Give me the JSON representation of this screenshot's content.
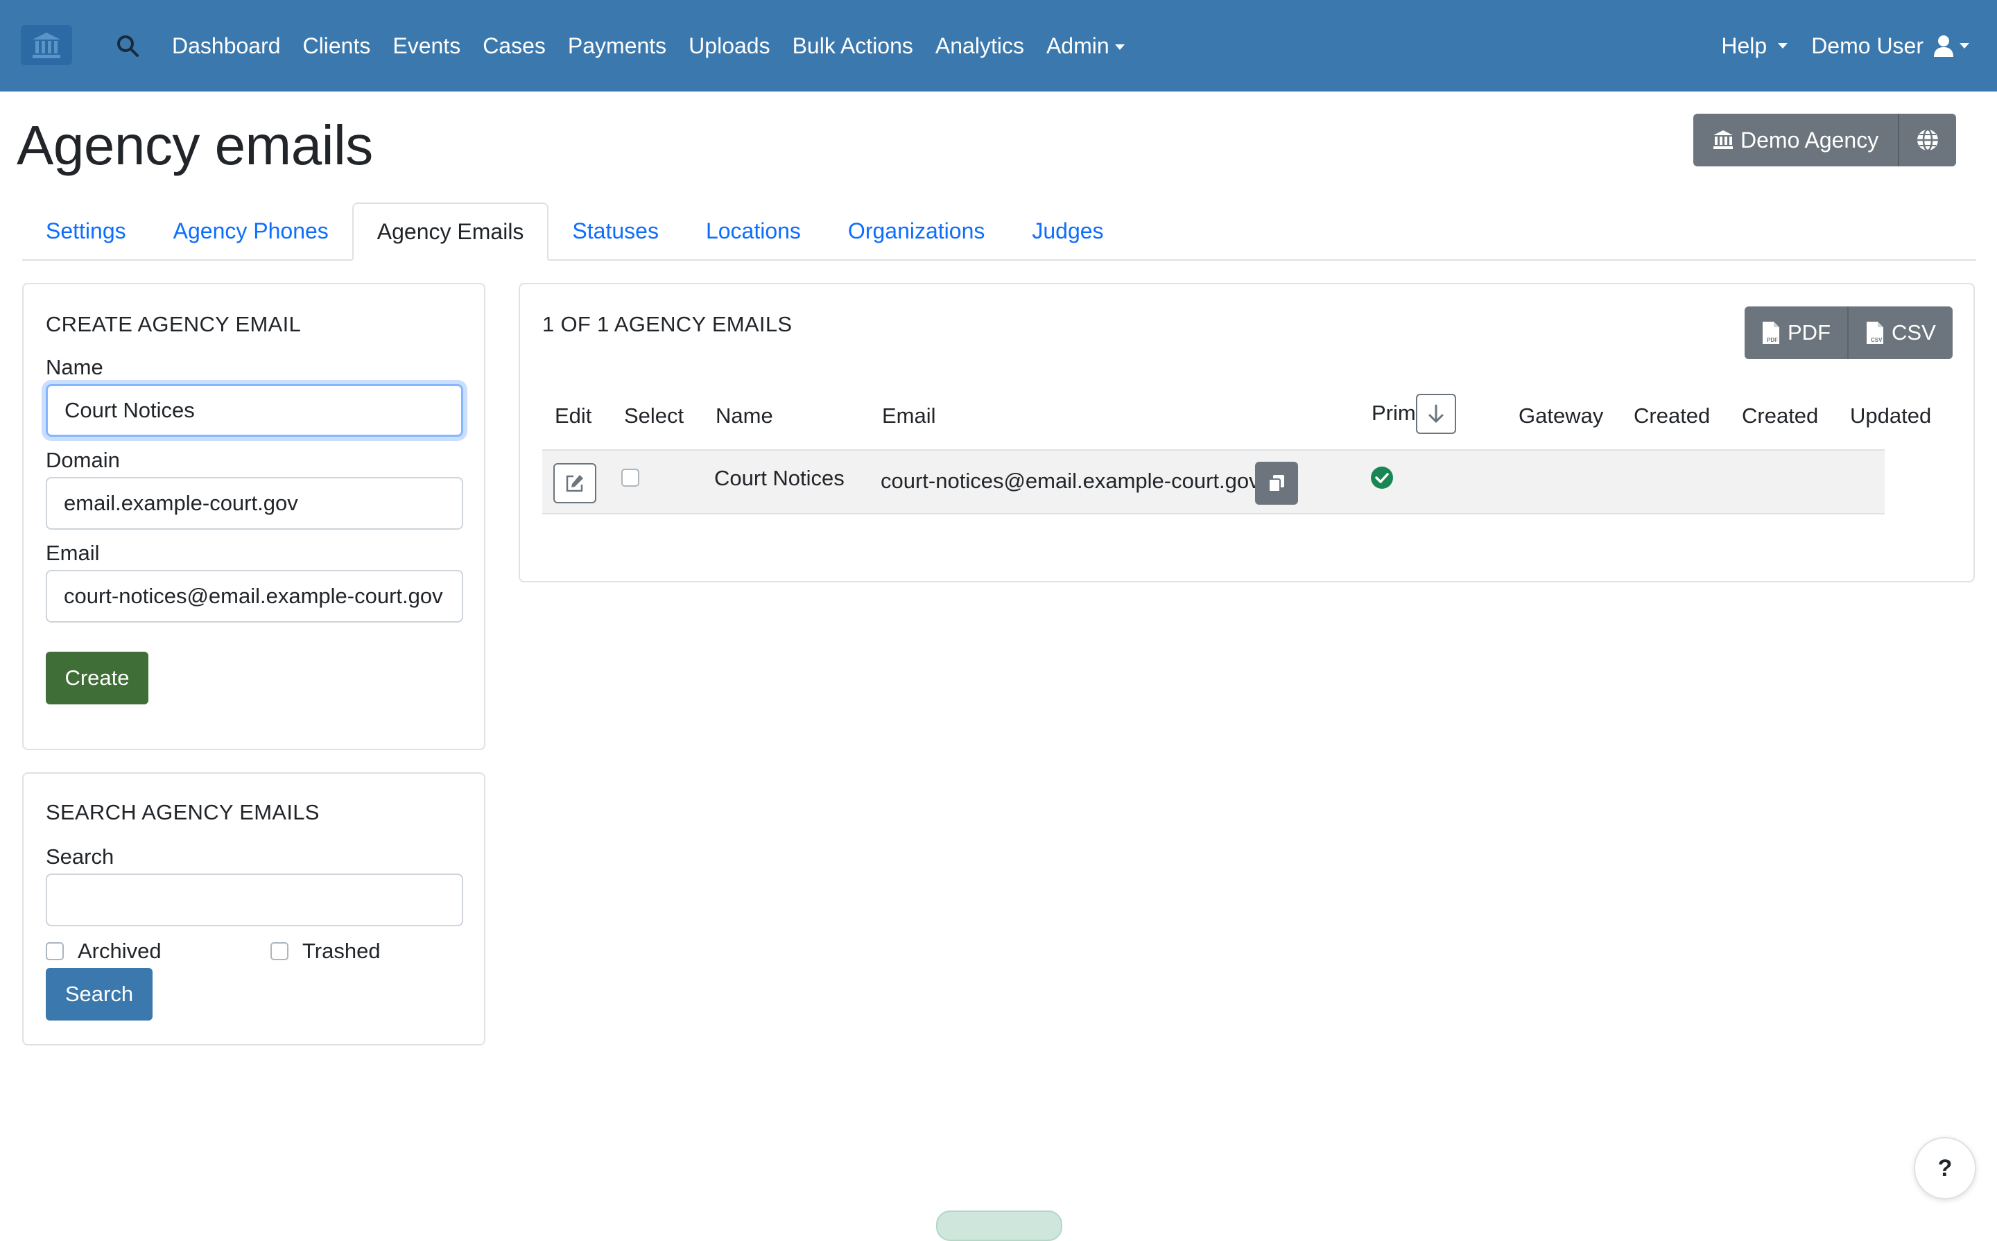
{
  "navbar": {
    "brand_icon": "courthouse-icon",
    "search_icon": "search-icon",
    "links": [
      "Dashboard",
      "Clients",
      "Events",
      "Cases",
      "Payments",
      "Uploads",
      "Bulk Actions",
      "Analytics",
      "Admin"
    ],
    "help_label": "Help",
    "user_label": "Demo User",
    "user_icon": "user-icon",
    "color": "#3a78ad"
  },
  "page": {
    "title": "Agency emails",
    "agency_button": "Demo Agency",
    "agency_icon": "bank-icon",
    "globe_icon": "globe-icon"
  },
  "tabs": [
    "Settings",
    "Agency Phones",
    "Agency Emails",
    "Statuses",
    "Locations",
    "Organizations",
    "Judges"
  ],
  "active_tab": "Agency Emails",
  "create_form": {
    "title": "CREATE AGENCY EMAIL",
    "name_label": "Name",
    "name_value": "Court Notices",
    "domain_label": "Domain",
    "domain_value": "email.example-court.gov",
    "email_label": "Email",
    "email_value": "court-notices@email.example-court.gov",
    "submit_label": "Create",
    "submit_color": "#3f6e36"
  },
  "search_form": {
    "title": "SEARCH AGENCY EMAILS",
    "search_label": "Search",
    "search_value": "",
    "archived_label": "Archived",
    "trashed_label": "Trashed",
    "submit_label": "Search"
  },
  "results": {
    "title": "1 OF 1 AGENCY EMAILS",
    "export_pdf": "PDF",
    "export_csv": "CSV",
    "columns": [
      "Edit",
      "Select",
      "Name",
      "Email",
      "Primary",
      "Gateway",
      "Created",
      "Created",
      "Updated"
    ],
    "rows": [
      {
        "name": "Court Notices",
        "email": "court-notices@email.example-court.gov",
        "primary": true,
        "gateway": "",
        "created": "",
        "created_2": "",
        "updated": ""
      }
    ],
    "primary_color": "#198754"
  },
  "help_button": "?"
}
